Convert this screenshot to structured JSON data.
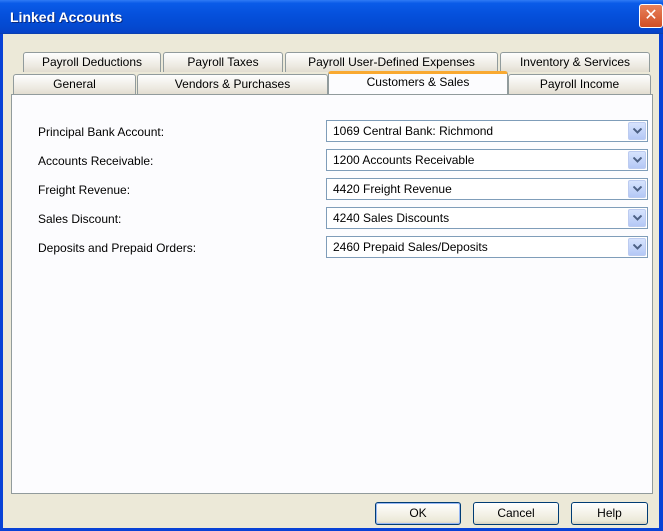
{
  "window": {
    "title": "Linked Accounts"
  },
  "tabs": {
    "top_row": [
      "Payroll Deductions",
      "Payroll Taxes",
      "Payroll User-Defined Expenses",
      "Inventory & Services"
    ],
    "bottom_row": [
      "General",
      "Vendors & Purchases",
      "Customers & Sales",
      "Payroll Income"
    ],
    "active": "Customers & Sales"
  },
  "fields": [
    {
      "label": "Principal Bank Account:",
      "value": "1069 Central Bank: Richmond"
    },
    {
      "label": "Accounts Receivable:",
      "value": "1200 Accounts Receivable"
    },
    {
      "label": "Freight Revenue:",
      "value": "4420 Freight Revenue"
    },
    {
      "label": "Sales Discount:",
      "value": "4240 Sales Discounts"
    },
    {
      "label": "Deposits and Prepaid Orders:",
      "value": "2460 Prepaid Sales/Deposits"
    }
  ],
  "buttons": {
    "ok": "OK",
    "cancel": "Cancel",
    "help": "Help"
  },
  "colors": {
    "titlebar": "#0550dc",
    "active_tab_accent": "#f9a931",
    "dialog_bg": "#ece9d8"
  },
  "icons": {
    "close": "close-icon",
    "dropdown": "chevron-down-icon"
  }
}
